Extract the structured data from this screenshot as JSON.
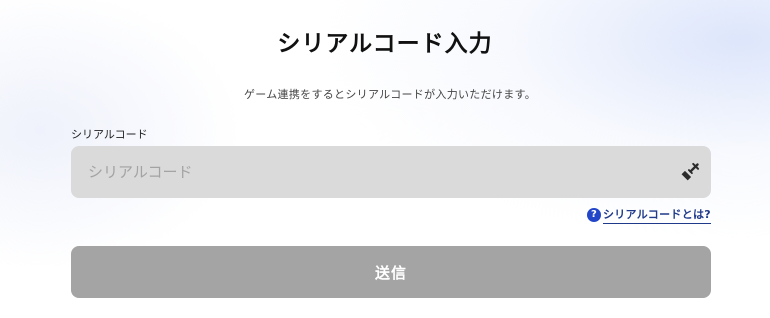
{
  "page": {
    "title": "シリアルコード入力",
    "description": "ゲーム連携をするとシリアルコードが入力いただけます。"
  },
  "form": {
    "field_label": "シリアルコード",
    "input_value": "",
    "input_placeholder": "シリアルコード",
    "paste_icon": "clipboard-paste-icon",
    "help_icon": "question-circle-icon",
    "help_link_label": "シリアルコードとは?",
    "submit_label": "送信"
  },
  "colors": {
    "input_background": "#dadada",
    "submit_background": "#a4a4a4",
    "link": "#1f3a8a",
    "help_icon": "#2346c9"
  }
}
